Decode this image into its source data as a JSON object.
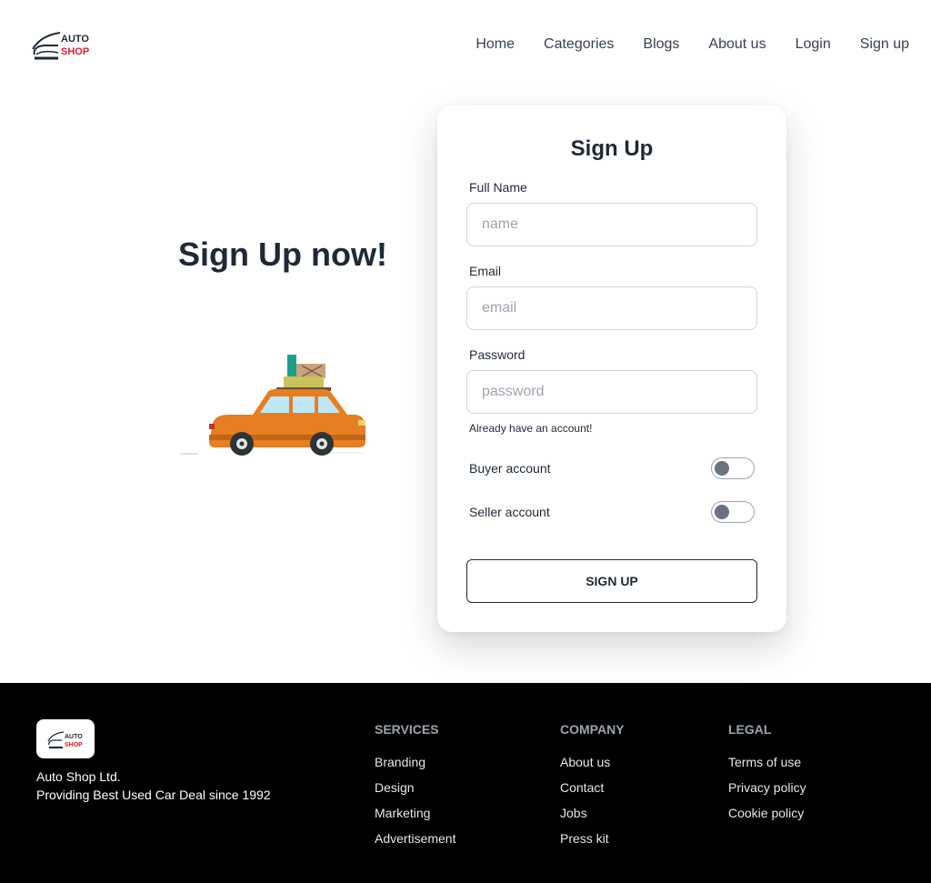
{
  "brand": {
    "logo_icon": "car-outline-icon",
    "logo_text_top": "AUTO",
    "logo_text_bottom": "SHOP",
    "accent": "#e11d2a"
  },
  "nav": {
    "links": [
      "Home",
      "Categories",
      "Blogs",
      "About us",
      "Login",
      "Sign up"
    ]
  },
  "hero": {
    "title": "Sign Up now!",
    "illustration": "car-with-luggage-illustration"
  },
  "form": {
    "title": "Sign Up",
    "full_name": {
      "label": "Full Name",
      "placeholder": "name",
      "value": ""
    },
    "email": {
      "label": "Email",
      "placeholder": "email",
      "value": ""
    },
    "password": {
      "label": "Password",
      "placeholder": "password",
      "value": ""
    },
    "already_account": "Already have an account!",
    "buyer_toggle": {
      "label": "Buyer account",
      "on": false
    },
    "seller_toggle": {
      "label": "Seller account",
      "on": false
    },
    "submit_label": "SIGN UP"
  },
  "footer": {
    "company_name": "Auto Shop Ltd.",
    "tagline": "Providing Best Used Car Deal since 1992",
    "columns": [
      {
        "title": "SERVICES",
        "links": [
          "Branding",
          "Design",
          "Marketing",
          "Advertisement"
        ]
      },
      {
        "title": "COMPANY",
        "links": [
          "About us",
          "Contact",
          "Jobs",
          "Press kit"
        ]
      },
      {
        "title": "LEGAL",
        "links": [
          "Terms of use",
          "Privacy policy",
          "Cookie policy"
        ]
      }
    ],
    "background": "#000000"
  }
}
